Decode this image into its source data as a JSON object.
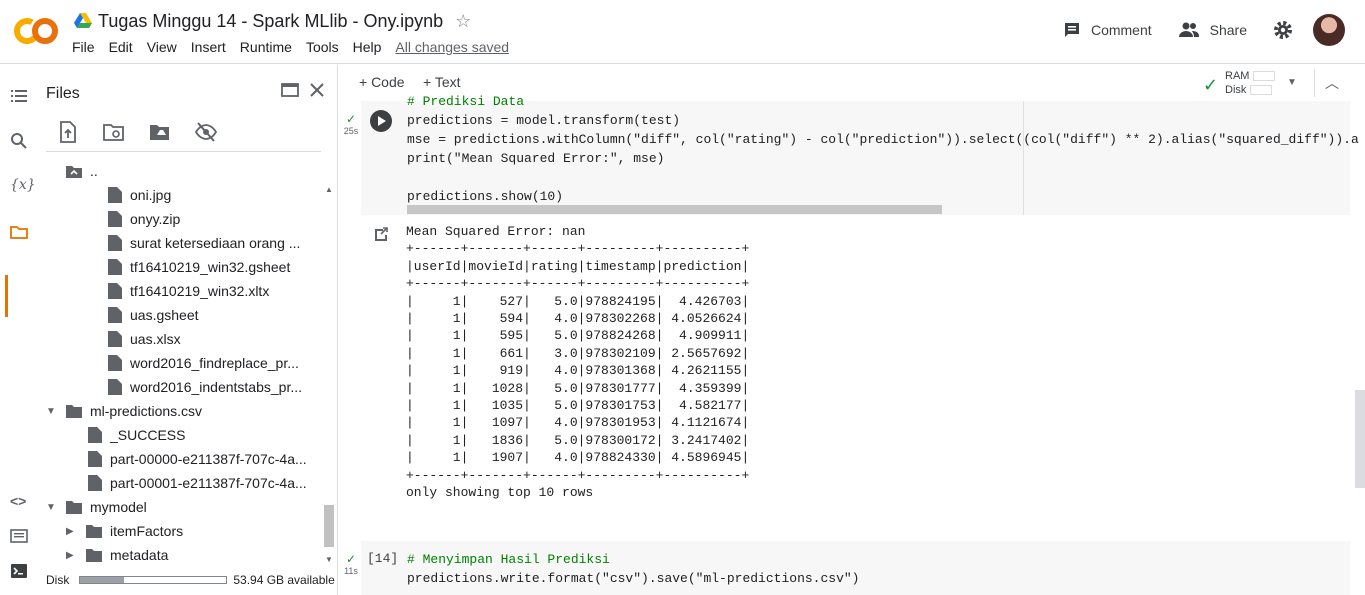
{
  "header": {
    "title": "Tugas Minggu 14 - Spark MLlib - Ony.ipynb",
    "menu": [
      "File",
      "Edit",
      "View",
      "Insert",
      "Runtime",
      "Tools",
      "Help"
    ],
    "saved_status": "All changes saved",
    "comment_label": "Comment",
    "share_label": "Share"
  },
  "files": {
    "title": "Files",
    "up_label": "..",
    "items": [
      {
        "label": "oni.jpg",
        "type": "file"
      },
      {
        "label": "onyy.zip",
        "type": "file"
      },
      {
        "label": "surat ketersediaan orang ...",
        "type": "file"
      },
      {
        "label": "tf16410219_win32.gsheet",
        "type": "file"
      },
      {
        "label": "tf16410219_win32.xltx",
        "type": "file"
      },
      {
        "label": "uas.gsheet",
        "type": "file"
      },
      {
        "label": "uas.xlsx",
        "type": "file"
      },
      {
        "label": "word2016_findreplace_pr...",
        "type": "file"
      },
      {
        "label": "word2016_indentstabs_pr...",
        "type": "file"
      },
      {
        "label": "ml-predictions.csv",
        "type": "folder-open"
      },
      {
        "label": "_SUCCESS",
        "type": "file"
      },
      {
        "label": "part-00000-e211387f-707c-4a...",
        "type": "file"
      },
      {
        "label": "part-00001-e211387f-707c-4a...",
        "type": "file"
      },
      {
        "label": "mymodel",
        "type": "folder-open"
      },
      {
        "label": "itemFactors",
        "type": "folder"
      },
      {
        "label": "metadata",
        "type": "folder"
      }
    ],
    "disk_label": "Disk",
    "disk_fraction": 0.3,
    "disk_available": "53.94 GB available"
  },
  "toolbar": {
    "code_label": "+ Code",
    "text_label": "+ Text",
    "ram_label": "RAM",
    "disk_label": "Disk"
  },
  "cell1": {
    "exec_time": "25s",
    "lines": [
      "# Prediksi Data",
      "predictions = model.transform(test)",
      "mse = predictions.withColumn(\"diff\", col(\"rating\") - col(\"prediction\")).select((col(\"diff\") ** 2).alias(\"squared_diff\")).a",
      "print(\"Mean Squared Error:\", mse)",
      "",
      "predictions.show(10)"
    ]
  },
  "output1": {
    "text": "Mean Squared Error: nan\n+------+-------+------+---------+----------+\n|userId|movieId|rating|timestamp|prediction|\n+------+-------+------+---------+----------+\n|     1|    527|   5.0|978824195|  4.426703|\n|     1|    594|   4.0|978302268| 4.0526624|\n|     1|    595|   5.0|978824268|  4.909911|\n|     1|    661|   3.0|978302109| 2.5657692|\n|     1|    919|   4.0|978301368| 4.2621155|\n|     1|   1028|   5.0|978301777|  4.359399|\n|     1|   1035|   5.0|978301753|  4.582177|\n|     1|   1097|   4.0|978301953| 4.1121674|\n|     1|   1836|   5.0|978300172| 3.2417402|\n|     1|   1907|   4.0|978824330| 4.5896945|\n+------+-------+------+---------+----------+\nonly showing top 10 rows"
  },
  "cell2": {
    "exec_time": "11s",
    "prompt": "[14]",
    "lines": [
      "# Menyimpan Hasil Prediksi",
      "predictions.write.format(\"csv\").save(\"ml-predictions.csv\")"
    ]
  }
}
